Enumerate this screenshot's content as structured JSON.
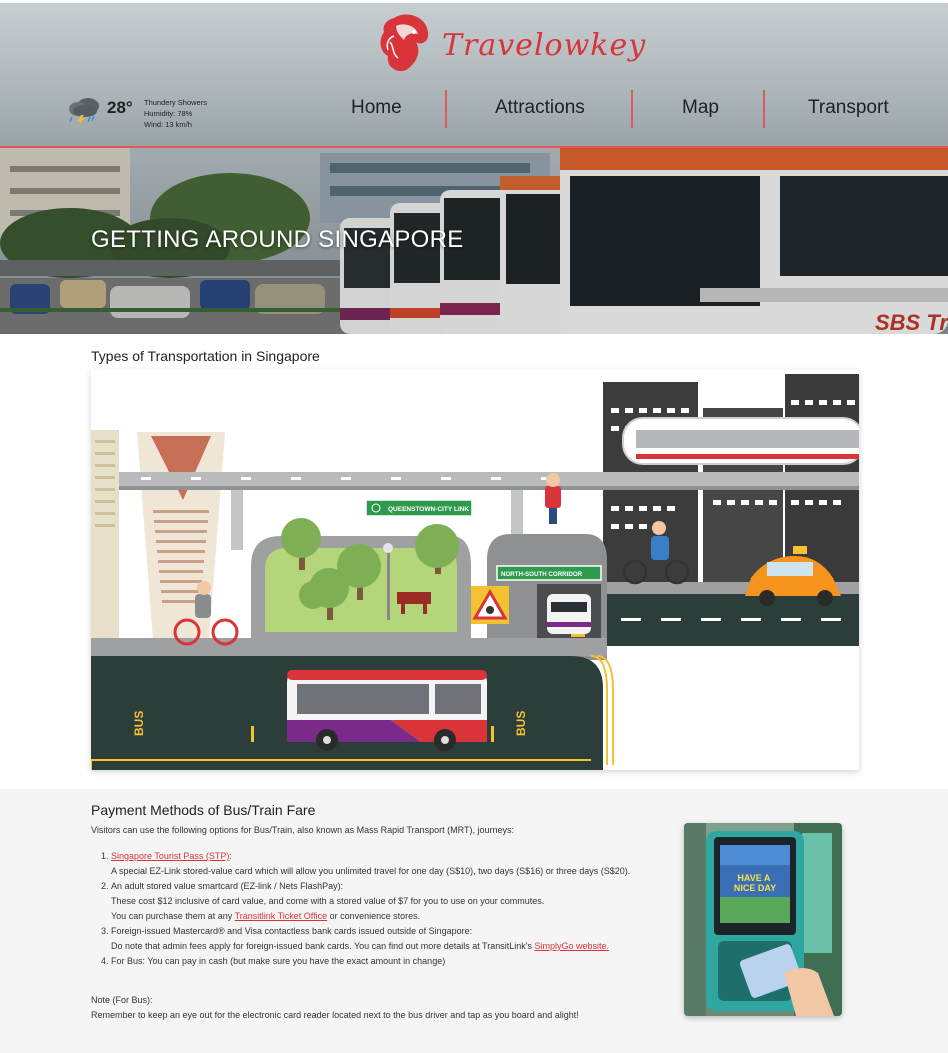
{
  "brand": {
    "name": "Travelowkey"
  },
  "weather": {
    "temperature": "28°",
    "condition": "Thundery Showers",
    "humidity": "Humidity: 78%",
    "wind": "Wind: 13 km/h",
    "icon": "thunderstorm-icon"
  },
  "nav": {
    "items": [
      {
        "label": "Home"
      },
      {
        "label": "Attractions"
      },
      {
        "label": "Map"
      },
      {
        "label": "Transport"
      }
    ]
  },
  "hero": {
    "title": "GETTING AROUND SINGAPORE",
    "bus_text": "SBS Tr"
  },
  "transport_section": {
    "title": "Types of Transportation in Singapore",
    "signs": {
      "link": "QUEENSTOWN-CITY LINK",
      "corridor": "NORTH-SOUTH CORRIDOR",
      "bus_lane": "BUS"
    }
  },
  "payment": {
    "title": "Payment Methods of Bus/Train Fare",
    "intro": "Visitors can use the following options for Bus/Train, also known as Mass Rapid Transport (MRT), journeys:",
    "items": [
      {
        "link": "Singapore Tourist Pass (STP)",
        "link_suffix": ":",
        "lines": [
          "A special EZ-Link stored-value card which will allow you unlimited travel for one day (S$10), two days (S$16) or three days (S$20)."
        ]
      },
      {
        "heading": "An adult stored value smartcard (EZ-link / Nets FlashPay):",
        "line1": "These cost $12 inclusive of card value, and come with a stored value of $7 for you to use on your commutes.",
        "line2_before": "You can purchase them at any ",
        "line2_link": "Transitlink Ticket Office",
        "line2_after": " or convenience stores."
      },
      {
        "heading": "Foreign-issued Mastercard® and Visa contactless bank cards issued outside of Singapore:",
        "line_before": "Do note that admin fees apply for foreign-issued bank cards. You can find out more details at TransitLink's ",
        "line_link": "SimplyGo website."
      },
      {
        "heading": "For Bus: You can pay in cash (but make sure you have the exact amount in change)"
      }
    ],
    "note_heading": "Note (For Bus):",
    "note_text": "Remember to keep an eye out for the electronic card reader located next to the bus driver and tap as you board and alight!",
    "reader_screen_text": "HAVE A NICE DAY"
  },
  "colors": {
    "accent": "#e0585a",
    "brand_red": "#d8343a",
    "link": "#d8343a",
    "section_bg": "#f5f5f5"
  }
}
